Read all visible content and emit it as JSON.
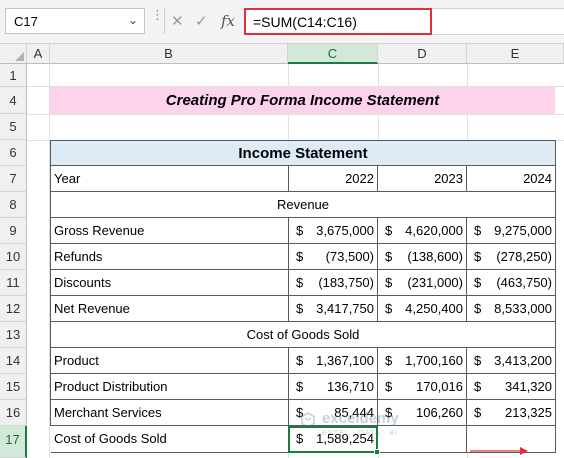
{
  "formula_bar": {
    "name_box": "C17",
    "formula": "=SUM(C14:C16)",
    "fx_label": "fx"
  },
  "columns": [
    "A",
    "B",
    "C",
    "D",
    "E"
  ],
  "rows": [
    "1",
    "4",
    "5",
    "6",
    "7",
    "8",
    "9",
    "10",
    "11",
    "12",
    "13",
    "14",
    "15",
    "16",
    "17"
  ],
  "sheet": {
    "title": "Creating Pro Forma Income Statement",
    "table_title": "Income Statement",
    "header": {
      "label": "Year",
      "c": "2022",
      "d": "2023",
      "e": "2024"
    },
    "section_revenue": "Revenue",
    "section_cogs": "Cost of Goods Sold",
    "rows": [
      {
        "label": "Gross Revenue",
        "c_cur": "$",
        "c": "3,675,000",
        "d_cur": "$",
        "d": "4,620,000",
        "e_cur": "$",
        "e": "9,275,000"
      },
      {
        "label": "Refunds",
        "c_cur": "$",
        "c": "(73,500)",
        "d_cur": "$",
        "d": "(138,600)",
        "e_cur": "$",
        "e": "(278,250)"
      },
      {
        "label": "Discounts",
        "c_cur": "$",
        "c": "(183,750)",
        "d_cur": "$",
        "d": "(231,000)",
        "e_cur": "$",
        "e": "(463,750)"
      },
      {
        "label": "Net Revenue",
        "c_cur": "$",
        "c": "3,417,750",
        "d_cur": "$",
        "d": "4,250,400",
        "e_cur": "$",
        "e": "8,533,000"
      },
      {
        "label": "Product",
        "c_cur": "$",
        "c": "1,367,100",
        "d_cur": "$",
        "d": "1,700,160",
        "e_cur": "$",
        "e": "3,413,200"
      },
      {
        "label": "Product Distribution",
        "c_cur": "$",
        "c": "136,710",
        "d_cur": "$",
        "d": "170,016",
        "e_cur": "$",
        "e": "341,320"
      },
      {
        "label": "Merchant Services",
        "c_cur": "$",
        "c": "85,444",
        "d_cur": "$",
        "d": "106,260",
        "e_cur": "$",
        "e": "213,325"
      },
      {
        "label": "Cost of Goods Sold",
        "c_cur": "$",
        "c": "1,589,254",
        "d_cur": "",
        "d": "",
        "e_cur": "",
        "e": ""
      }
    ]
  },
  "watermark": {
    "name": "exceldemy",
    "sub": "EXCEL · DATA · BI"
  },
  "colors": {
    "accent": "#1d7a41",
    "title_fill": "#fdd3ec",
    "header_fill": "#ddebf7",
    "formula_border": "#e0303a"
  }
}
